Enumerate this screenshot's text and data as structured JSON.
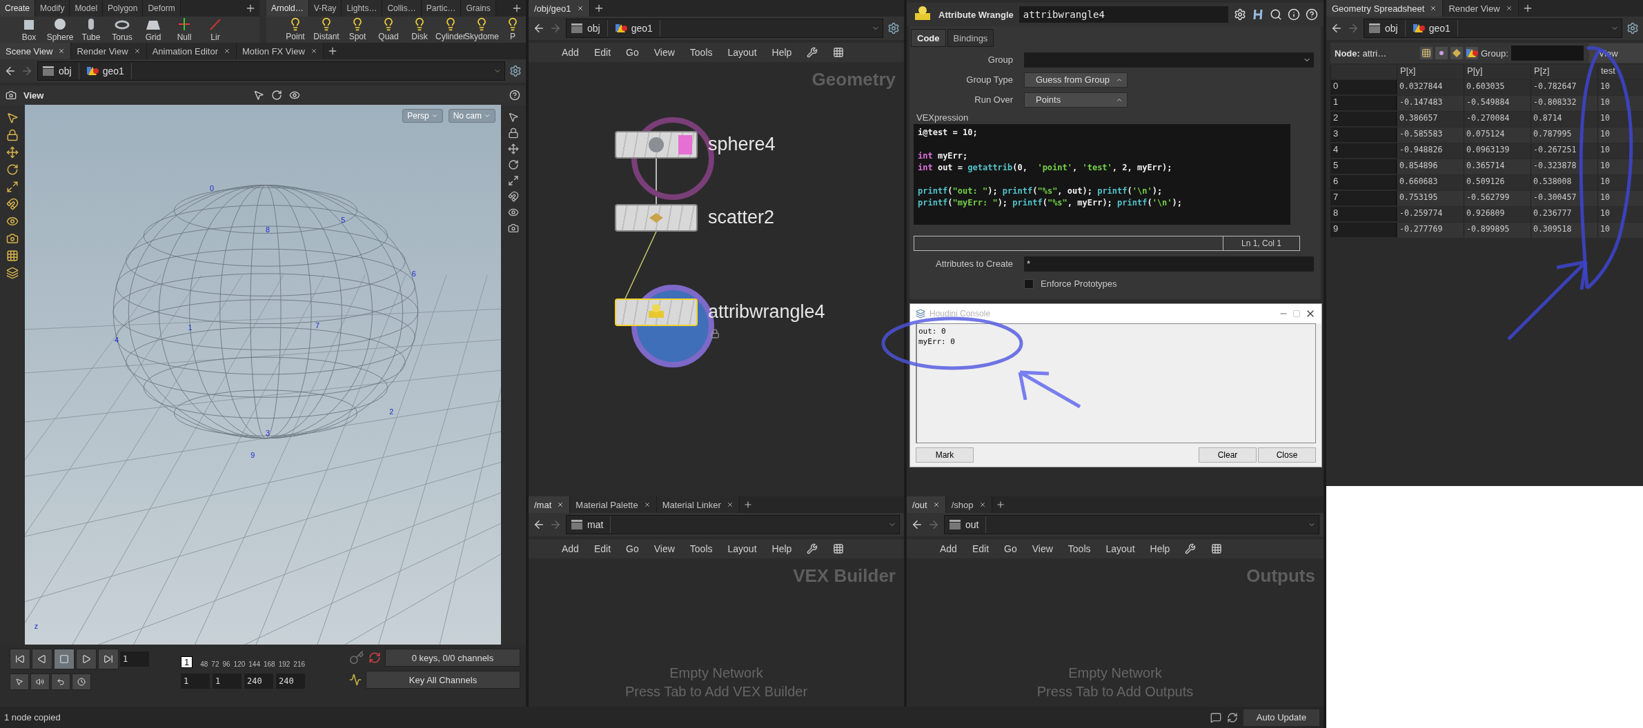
{
  "shelves": [
    {
      "tabs": [
        {
          "label": "Create",
          "selected": true
        },
        {
          "label": "Modify",
          "selected": false
        },
        {
          "label": "Model",
          "selected": false
        },
        {
          "label": "Polygon",
          "selected": false
        },
        {
          "label": "Deform",
          "selected": false
        }
      ],
      "tools": [
        "Box",
        "Sphere",
        "Tube",
        "Torus",
        "Grid",
        "Null",
        "Lir"
      ]
    },
    {
      "tabs": [
        {
          "label": "Arnold…",
          "selected": true
        },
        {
          "label": "V-Ray",
          "selected": false
        },
        {
          "label": "Lights…",
          "selected": false
        },
        {
          "label": "Collis…",
          "selected": false
        },
        {
          "label": "Partic…",
          "selected": false
        },
        {
          "label": "Grains",
          "selected": false
        }
      ],
      "tools": [
        "Point",
        "Distant",
        "Spot",
        "Quad",
        "Disk",
        "Cylinder",
        "Skydome",
        "P"
      ]
    }
  ],
  "scene_view": {
    "tabs": [
      {
        "label": "Scene View",
        "selected": true
      },
      {
        "label": "Render View",
        "selected": false
      },
      {
        "label": "Animation Editor",
        "selected": false
      },
      {
        "label": "Motion FX View",
        "selected": false
      }
    ],
    "path": [
      "obj",
      "geo1"
    ],
    "title": "View",
    "camera_buttons": [
      "Persp",
      "No cam"
    ],
    "point_labels": [
      "0",
      "1",
      "2",
      "3",
      "4",
      "5",
      "6",
      "7",
      "8",
      "9"
    ],
    "axis_label": "z"
  },
  "timeline": {
    "frame": "1",
    "marker": "1",
    "ticks": [
      "48",
      "72",
      "96",
      "120",
      "144",
      "168",
      "192",
      "216"
    ],
    "range": [
      "1",
      "1",
      "240",
      "240"
    ],
    "keys_status": "0 keys, 0/0 channels",
    "key_mode": "Key All Channels"
  },
  "network": {
    "tabs": [
      {
        "label": "/obj/geo1",
        "selected": true
      }
    ],
    "path": [
      "obj",
      "geo1"
    ],
    "menu": [
      "Add",
      "Edit",
      "Go",
      "View",
      "Tools",
      "Layout",
      "Help"
    ],
    "context_label": "Geometry",
    "nodes": [
      {
        "name": "sphere4",
        "kind": "sphere",
        "selected": false,
        "locked": false
      },
      {
        "name": "scatter2",
        "kind": "scatter",
        "selected": false,
        "locked": false
      },
      {
        "name": "attribwrangle4",
        "kind": "wrangle",
        "selected": true,
        "locked": true
      }
    ]
  },
  "parameters": {
    "type_label": "Attribute Wrangle",
    "name": "attribwrangle4",
    "tabs": [
      {
        "label": "Code",
        "selected": true
      },
      {
        "label": "Bindings",
        "selected": false
      }
    ],
    "fields": [
      {
        "label": "Group",
        "kind": "text"
      },
      {
        "label": "Group Type",
        "kind": "menu",
        "value": "Guess from Group"
      },
      {
        "label": "Run Over",
        "kind": "menu",
        "value": "Points"
      }
    ],
    "code_label": "VEXpression",
    "code": [
      {
        "blank_before": false,
        "tokens": [
          {
            "t": "i@test = 10;",
            "kind": "plain"
          }
        ]
      },
      {
        "blank_before": true,
        "tokens": [
          {
            "t": "int",
            "kind": "keyword"
          },
          {
            "t": " myErr;",
            "kind": "plain"
          }
        ]
      },
      {
        "blank_before": false,
        "tokens": [
          {
            "t": "int",
            "kind": "keyword"
          },
          {
            "t": " out = ",
            "kind": "plain"
          },
          {
            "t": "getattrib",
            "kind": "function"
          },
          {
            "t": "(0,  ",
            "kind": "plain"
          },
          {
            "t": "'point'",
            "kind": "string"
          },
          {
            "t": ", ",
            "kind": "plain"
          },
          {
            "t": "'test'",
            "kind": "string"
          },
          {
            "t": ", 2, myErr);",
            "kind": "plain"
          }
        ]
      },
      {
        "blank_before": true,
        "tokens": [
          {
            "t": "printf",
            "kind": "function"
          },
          {
            "t": "(",
            "kind": "plain"
          },
          {
            "t": "\"out: \"",
            "kind": "string"
          },
          {
            "t": "); ",
            "kind": "plain"
          },
          {
            "t": "printf",
            "kind": "function"
          },
          {
            "t": "(",
            "kind": "plain"
          },
          {
            "t": "\"%s\"",
            "kind": "string"
          },
          {
            "t": ", out); ",
            "kind": "plain"
          },
          {
            "t": "printf",
            "kind": "function"
          },
          {
            "t": "(",
            "kind": "plain"
          },
          {
            "t": "'\\n'",
            "kind": "string"
          },
          {
            "t": ");",
            "kind": "plain"
          }
        ]
      },
      {
        "blank_before": false,
        "tokens": [
          {
            "t": "printf",
            "kind": "function"
          },
          {
            "t": "(",
            "kind": "plain"
          },
          {
            "t": "\"myErr: \"",
            "kind": "string"
          },
          {
            "t": "); ",
            "kind": "plain"
          },
          {
            "t": "printf",
            "kind": "function"
          },
          {
            "t": "(",
            "kind": "plain"
          },
          {
            "t": "\"%s\"",
            "kind": "string"
          },
          {
            "t": ", myErr); ",
            "kind": "plain"
          },
          {
            "t": "printf",
            "kind": "function"
          },
          {
            "t": "(",
            "kind": "plain"
          },
          {
            "t": "'\\n'",
            "kind": "string"
          },
          {
            "t": ");",
            "kind": "plain"
          }
        ]
      }
    ],
    "cursor_position": "Ln 1, Col 1",
    "attributes": {
      "label": "Attributes to Create",
      "value": "*"
    },
    "enforce": {
      "label": "Enforce Prototypes",
      "checked": false
    }
  },
  "console": {
    "title": "Houdini Console",
    "lines": [
      "out: 0",
      "myErr: 0"
    ],
    "buttons": [
      "Mark",
      "Clear",
      "Close"
    ]
  },
  "bottom_panes": [
    {
      "tabs": [
        {
          "label": "/mat",
          "selected": true
        },
        {
          "label": "Material Palette",
          "selected": false
        },
        {
          "label": "Material Linker",
          "selected": false
        }
      ],
      "path": "mat",
      "menu": [
        "Add",
        "Edit",
        "Go",
        "View",
        "Tools",
        "Layout",
        "Help"
      ],
      "context_label": "VEX Builder",
      "empty_title": "Empty Network",
      "empty_hint": "Press Tab to Add VEX Builder"
    },
    {
      "tabs": [
        {
          "label": "/out",
          "selected": true
        },
        {
          "label": "/shop",
          "selected": false
        }
      ],
      "path": "out",
      "menu": [
        "Add",
        "Edit",
        "Go",
        "View",
        "Tools",
        "Layout",
        "Help"
      ],
      "context_label": "Outputs",
      "empty_title": "Empty Network",
      "empty_hint": "Press Tab to Add Outputs"
    }
  ],
  "spreadsheet": {
    "tabs": [
      {
        "label": "Geometry Spreadsheet",
        "selected": true
      },
      {
        "label": "Render View",
        "selected": false
      }
    ],
    "path": [
      "obj",
      "geo1"
    ],
    "node_label": "**Node:** attri…",
    "group_label": "Group:",
    "view_button": "View",
    "columns": [
      "P[x]",
      "P[y]",
      "P[z]",
      "test"
    ],
    "rows": [
      {
        "index": "0",
        "cells": [
          "0.0327844",
          "0.603035",
          "-0.782647",
          "10"
        ]
      },
      {
        "index": "1",
        "cells": [
          "-0.147483",
          "-0.549884",
          "-0.808332",
          "10"
        ]
      },
      {
        "index": "2",
        "cells": [
          "0.386657",
          "-0.270084",
          "0.8714",
          "10"
        ]
      },
      {
        "index": "3",
        "cells": [
          "-0.585583",
          "0.075124",
          "0.787995",
          "10"
        ]
      },
      {
        "index": "4",
        "cells": [
          "-0.948826",
          "0.0963139",
          "-0.267251",
          "10"
        ]
      },
      {
        "index": "5",
        "cells": [
          "0.854896",
          "0.365714",
          "-0.323878",
          "10"
        ]
      },
      {
        "index": "6",
        "cells": [
          "0.660683",
          "0.509126",
          "0.538008",
          "10"
        ]
      },
      {
        "index": "7",
        "cells": [
          "0.753195",
          "-0.562799",
          "-0.300457",
          "10"
        ]
      },
      {
        "index": "8",
        "cells": [
          "-0.259774",
          "0.926809",
          "0.236777",
          "10"
        ]
      },
      {
        "index": "9",
        "cells": [
          "-0.277769",
          "-0.899895",
          "0.309518",
          "10"
        ]
      }
    ]
  },
  "status_bar": {
    "message": "1 node copied",
    "auto_update": "Auto Update"
  }
}
